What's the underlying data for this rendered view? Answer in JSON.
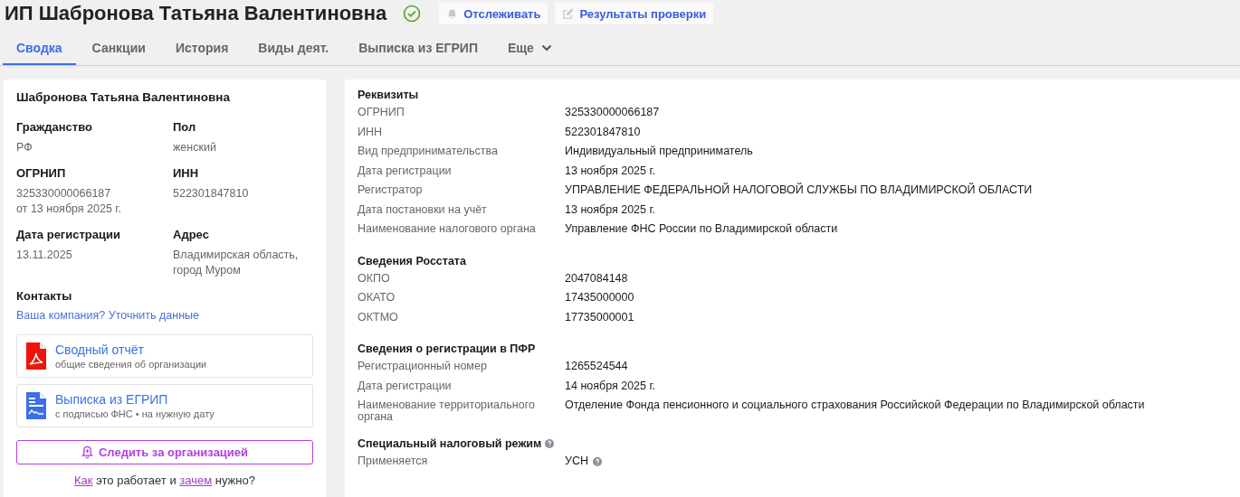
{
  "header": {
    "title": "ИП Шабронова Татьяна Валентиновна",
    "verified": true,
    "buttons": [
      {
        "label": "Отслеживать",
        "kind": "bell"
      },
      {
        "label": "Результаты проверки",
        "kind": "edit"
      }
    ]
  },
  "tabs": [
    {
      "label": "Сводка",
      "selected": true,
      "kind": "plain"
    },
    {
      "label": "Санкции",
      "selected": false,
      "kind": "plain"
    },
    {
      "label": "История",
      "selected": false,
      "kind": "plain"
    },
    {
      "label": "Виды деят.",
      "selected": false,
      "kind": "plain"
    },
    {
      "label": "Выписка из ЕГРИП",
      "selected": false,
      "kind": "plain"
    },
    {
      "label": "Еще",
      "selected": false,
      "kind": "dropdown"
    }
  ],
  "summary": {
    "name": "Шабронова Татьяна Валентиновна",
    "fields": [
      {
        "label": "Гражданство",
        "value": [
          "РФ"
        ]
      },
      {
        "label": "Пол",
        "value": [
          "женский"
        ]
      },
      {
        "label": "ОГРНИП",
        "value": [
          "325330000066187",
          "от 13 ноября 2025 г."
        ]
      },
      {
        "label": "ИНН",
        "value": [
          "522301847810"
        ]
      },
      {
        "label": "Дата регистрации",
        "value": [
          "13.11.2025"
        ]
      },
      {
        "label": "Адрес",
        "value": [
          "Владимирская область, город Муром"
        ]
      }
    ],
    "contacts_title": "Контакты",
    "contacts_link": "Ваша компания? Уточнить данные",
    "documents": [
      {
        "title": "Сводный отчёт",
        "subtitle": "общие сведения об организации",
        "kind": "pdf"
      },
      {
        "title": "Выписка из ЕГРИП",
        "subtitle": "с подписью ФНС • на нужную дату",
        "kind": "doc"
      }
    ],
    "follow_button": "Следить за организацией",
    "help_sentence": [
      {
        "text": "Как",
        "link": true
      },
      {
        "text": " это работает и ",
        "link": false
      },
      {
        "text": "зачем",
        "link": true
      },
      {
        "text": " нужно?",
        "link": false
      }
    ]
  },
  "details": [
    {
      "title": "Реквизиты",
      "rows": [
        {
          "label": "ОГРНИП",
          "value": "325330000066187"
        },
        {
          "label": "ИНН",
          "value": "522301847810"
        },
        {
          "label": "Вид предпринимательства",
          "value": "Индивидуальный предприниматель"
        },
        {
          "label": "Дата регистрации",
          "value": "13 ноября 2025 г."
        },
        {
          "label": "Регистратор",
          "value": "УПРАВЛЕНИЕ ФЕДЕРАЛЬНОЙ НАЛОГОВОЙ СЛУЖБЫ ПО ВЛАДИМИРСКОЙ ОБЛАСТИ"
        },
        {
          "label": "Дата постановки на учёт",
          "value": "13 ноября 2025 г."
        },
        {
          "label": "Наименование налогового органа",
          "value": "Управление ФНС России по Владимирской области"
        }
      ]
    },
    {
      "title": "Сведения Росстата",
      "rows": [
        {
          "label": "ОКПО",
          "value": "2047084148"
        },
        {
          "label": "ОКАТО",
          "value": "17435000000"
        },
        {
          "label": "ОКТМО",
          "value": "17735000001"
        }
      ]
    },
    {
      "title": "Сведения о регистрации в ПФР",
      "rows": [
        {
          "label": "Регистрационный номер",
          "value": "1265524544"
        },
        {
          "label": "Дата регистрации",
          "value": "14 ноября 2025 г."
        },
        {
          "label": "Наименование территориального органа",
          "value": "Отделение Фонда пенсионного и социального страхования Российской Федерации по Владимирской области"
        }
      ]
    },
    {
      "title": "Специальный налоговый режим",
      "help": true,
      "rows": [
        {
          "label": "Применяется",
          "value": "УСН",
          "help": true
        }
      ]
    }
  ]
}
